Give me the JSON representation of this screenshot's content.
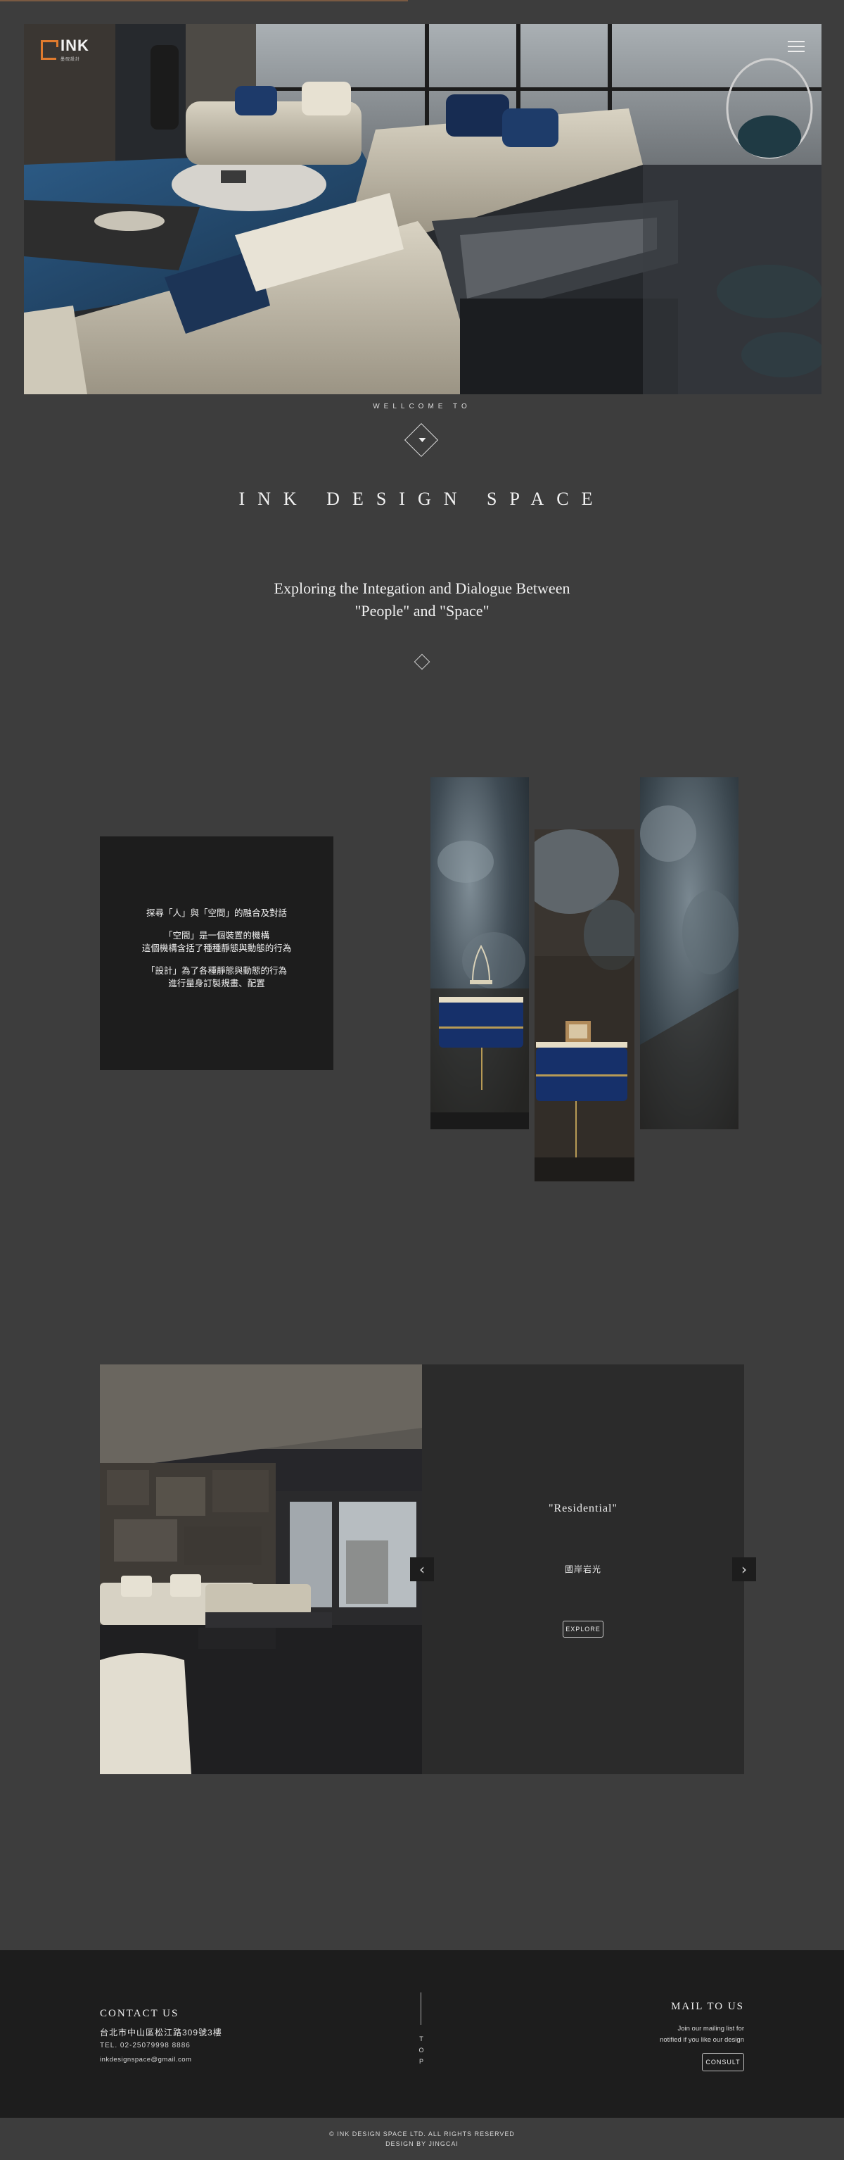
{
  "brand": {
    "name": "INK",
    "sub": "墨砚設計"
  },
  "hero": {
    "welcome": "WELLCOME TO"
  },
  "intro": {
    "site_title": "INK DESIGN SPACE",
    "tagline_line1": "Exploring the Integation and Dialogue Between",
    "tagline_line2": "\"People\" and \"Space\""
  },
  "philosophy": {
    "line1": "探尋「人」與「空間」的融合及對話",
    "line2": "「空間」是一個裝置的機構",
    "line3": "這個機構含括了種種靜態與動態的行為",
    "line4": "「設計」為了各種靜態與動態的行為",
    "line5": "進行量身訂製規畫、配置"
  },
  "portfolio": {
    "name": "\"Residential\"",
    "subtitle": "國岸岩光",
    "explore_label": "EXPLORE",
    "prev_icon": "chevron-left-icon",
    "next_icon": "chevron-right-icon"
  },
  "footer": {
    "contact_title": "CONTACT US",
    "address": "台北市中山區松江路309號3樓",
    "tel": "TEL. 02-25079998 8886",
    "email": "inkdesignspace@gmail.com",
    "top_label": "TOP",
    "mail_title": "MAIL TO US",
    "mail_desc_line1": "Join our mailing list for",
    "mail_desc_line2": "notified if you like our design",
    "consult_label": "CONSULT"
  },
  "copyright": {
    "line1": "© INK DESIGN SPACE LTD. ALL RIGHTS RESERVED",
    "line2": "DESIGN BY JINGCAI"
  },
  "colors": {
    "accent": "#e07b2e",
    "page_bg": "#3d3d3d",
    "dark": "#1d1d1d"
  }
}
